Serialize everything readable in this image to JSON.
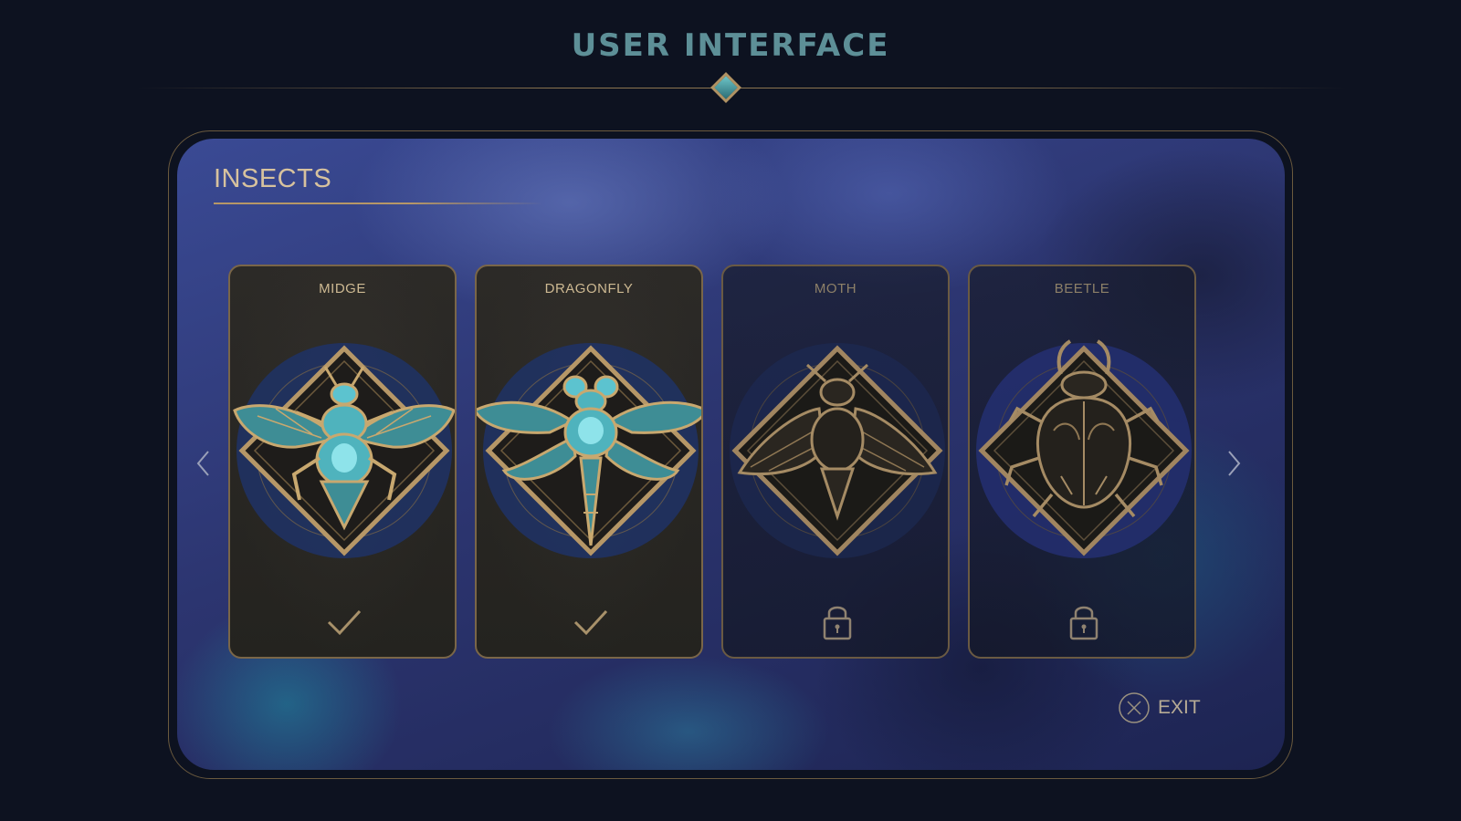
{
  "header": {
    "title": "USER INTERFACE"
  },
  "section": {
    "title": "INSECTS"
  },
  "nav": {
    "prev_icon": "chevron-left-icon",
    "next_icon": "chevron-right-icon"
  },
  "cards": [
    {
      "title": "MIDGE",
      "state": "unlocked",
      "status_icon": "checkmark-icon",
      "emblem": "midge-emblem-icon"
    },
    {
      "title": "DRAGONFLY",
      "state": "unlocked",
      "status_icon": "checkmark-icon",
      "emblem": "dragonfly-emblem-icon"
    },
    {
      "title": "MOTH",
      "state": "locked",
      "status_icon": "lock-icon",
      "emblem": "moth-emblem-icon"
    },
    {
      "title": "BEETLE",
      "state": "locked",
      "status_icon": "lock-icon",
      "emblem": "beetle-emblem-icon"
    }
  ],
  "exit": {
    "label": "EXIT",
    "icon": "close-circle-icon"
  },
  "colors": {
    "background": "#0d1220",
    "gold": "#b69767",
    "teal": "#4fb3bd",
    "header_text": "#5d8f97",
    "panel_blue": "#2c3570"
  }
}
